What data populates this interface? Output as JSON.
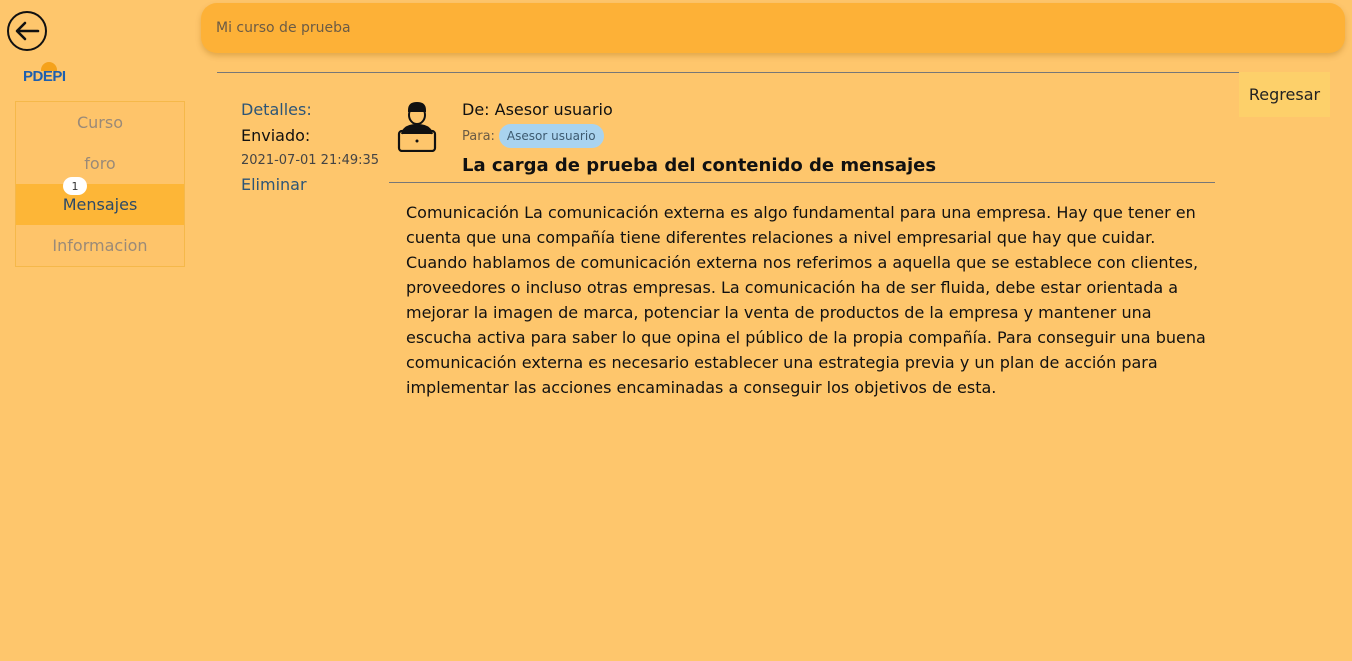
{
  "app": {
    "logo_text": "PDEPI"
  },
  "header": {
    "course_title": "Mi curso de prueba"
  },
  "sidebar": {
    "items": [
      {
        "label": "Curso"
      },
      {
        "label": "foro"
      },
      {
        "label": "Mensajes",
        "badge": "1"
      },
      {
        "label": "Informacion"
      }
    ]
  },
  "actions": {
    "back_label": "Regresar"
  },
  "message": {
    "details_label": "Detalles:",
    "sent_label": "Enviado:",
    "sent_date": "2021-07-01 21:49:35",
    "delete_label": "Eliminar",
    "from": "De: Asesor usuario",
    "to_label": "Para:",
    "to_recipient": "Asesor usuario",
    "subject": "La carga de prueba del contenido de mensajes",
    "body": "Comunicación La comunicación externa es algo fundamental para una empresa. Hay que tener en cuenta que una compañía tiene diferentes relaciones a nivel empresarial que hay que cuidar. Cuando hablamos de comunicación externa nos referimos a aquella que se establece con clientes, proveedores o incluso otras empresas. La comunicación ha de ser fluida, debe estar orientada a mejorar la imagen de marca, potenciar la venta de productos de la empresa y mantener una escucha activa para saber lo que opina el público de la propia compañía. Para conseguir una buena comunicación externa es necesario establecer una estrategia previa y un plan de acción para implementar las acciones encaminadas a conseguir los objetivos de esta."
  },
  "icons": {
    "back": "arrow-left-circle-icon",
    "avatar": "user-laptop-icon"
  },
  "colors": {
    "background": "#fec66c",
    "topbar": "#fdb137",
    "active_item": "#fdb637",
    "link": "#2d5577",
    "chip": "#a9d3ef"
  }
}
